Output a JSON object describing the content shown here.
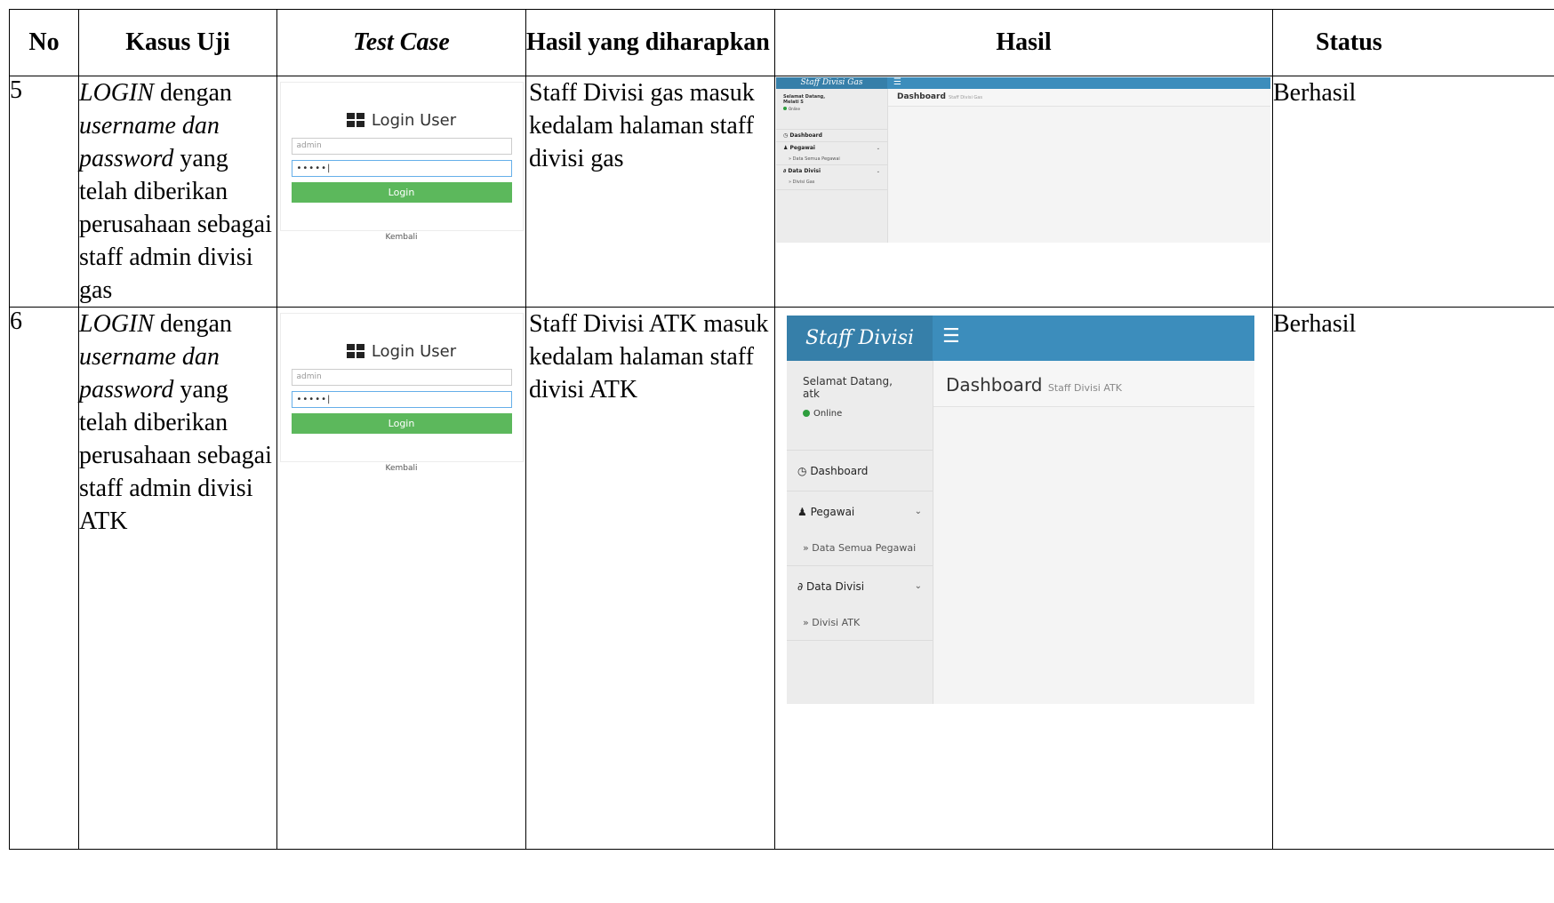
{
  "headers": {
    "no": "No",
    "kasus_uji": "Kasus Uji",
    "test_case": "Test Case",
    "hasil_diharapkan": "Hasil yang diharapkan",
    "hasil": "Hasil",
    "status": "Status"
  },
  "rows": [
    {
      "no": "5",
      "kasus": {
        "login": "LOGIN",
        "dengan": " dengan ",
        "cred": "username dan password",
        "rest": " yang telah diberikan perusahaan sebagai staff admin divisi gas"
      },
      "login_mock": {
        "title": "Login User",
        "username_value": "admin",
        "password_value": "•••••|",
        "button": "Login",
        "kembali": "Kembali"
      },
      "expected": "Staff Divisi gas masuk kedalam halaman staff divisi gas",
      "dashboard": {
        "brand": "Staff Divisi Gas",
        "greeting": "Selamat Datang, Melati S",
        "online": "Online",
        "page_title": "Dashboard",
        "page_subtitle": "Staff Divisi Gas",
        "menu": {
          "dashboard": "Dashboard",
          "pegawai": "Pegawai",
          "data_semua_pegawai": "» Data Semua Pegawai",
          "data_divisi": "Data Divisi",
          "divisi": "» Divisi Gas"
        }
      },
      "status": "Berhasil"
    },
    {
      "no": "6",
      "kasus": {
        "login": "LOGIN",
        "dengan": " dengan ",
        "cred": "username dan password",
        "rest": " yang telah diberikan perusahaan sebagai staff admin divisi ATK"
      },
      "login_mock": {
        "title": "Login User",
        "username_value": "admin",
        "password_value": "•••••|",
        "button": "Login",
        "kembali": "Kembali"
      },
      "expected": "Staff Divisi ATK masuk kedalam halaman staff divisi ATK",
      "dashboard": {
        "brand": "Staff Divisi ATK",
        "greeting_line1": "Selamat Datang,",
        "greeting_line2": "atk",
        "online": "Online",
        "page_title": "Dashboard",
        "page_subtitle": "Staff Divisi ATK",
        "menu": {
          "dashboard": "Dashboard",
          "pegawai": "Pegawai",
          "data_semua_pegawai": "» Data Semua Pegawai",
          "data_divisi": "Data Divisi",
          "divisi": "» Divisi ATK"
        }
      },
      "status": "Berhasil"
    }
  ],
  "colors": {
    "topbar": "#3c8dbc",
    "brand": "#367fa9",
    "login_button": "#5cb85c",
    "online_dot": "#2e9e3e"
  }
}
